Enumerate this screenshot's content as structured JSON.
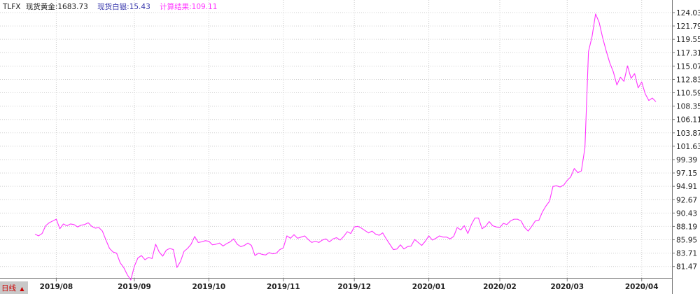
{
  "header": {
    "symbol": "TLFX",
    "gold_label": "现货黄金:1683.73",
    "silver_label": "现货白银:15.43",
    "result_label": "计算结果:109.11"
  },
  "period": {
    "label": "日线",
    "arrow": "▲"
  },
  "colors": {
    "line": "#ff33ff",
    "gold_text": "#222222",
    "silver_text": "#3333aa",
    "result_text": "#ff33ff",
    "grid": "#cfcfcf",
    "axis": "#777777",
    "period_bg": "#c8c8c8",
    "period_text": "#cc0000"
  },
  "chart_data": {
    "type": "line",
    "title": "",
    "xlabel": "",
    "ylabel": "",
    "ylim": [
      79.2,
      124.03
    ],
    "grid": true,
    "y_ticks": [
      "124.03",
      "121.79",
      "119.55",
      "117.31",
      "115.07",
      "112.83",
      "110.59",
      "108.35",
      "106.11",
      "103.87",
      "101.63",
      "99.39",
      "97.15",
      "94.91",
      "92.67",
      "90.43",
      "88.19",
      "85.95",
      "83.71",
      "81.47"
    ],
    "x_ticks": [
      "2019/08",
      "2019/09",
      "2019/10",
      "2019/11",
      "2019/12",
      "2020/01",
      "2020/02",
      "2020/03",
      "2020/04"
    ],
    "x_tick_index": [
      6,
      28,
      49,
      70,
      90,
      111,
      131,
      150,
      171
    ],
    "series": [
      {
        "values": [
          86.9,
          86.6,
          87.0,
          88.3,
          88.8,
          89.1,
          89.4,
          87.8,
          88.6,
          88.3,
          88.6,
          88.5,
          88.1,
          88.4,
          88.5,
          88.8,
          88.2,
          87.9,
          88.0,
          87.4,
          85.9,
          84.5,
          83.9,
          83.7,
          82.1,
          81.3,
          80.1,
          79.2,
          81.5,
          82.9,
          83.3,
          82.6,
          83.0,
          82.8,
          85.2,
          83.9,
          83.2,
          84.2,
          84.5,
          84.3,
          81.3,
          82.3,
          84.0,
          84.5,
          85.2,
          86.5,
          85.5,
          85.6,
          85.8,
          85.7,
          85.1,
          85.2,
          85.4,
          84.9,
          85.3,
          85.6,
          86.1,
          85.2,
          84.8,
          85.0,
          85.4,
          85.0,
          83.3,
          83.7,
          83.5,
          83.4,
          83.8,
          83.6,
          83.7,
          84.3,
          84.6,
          86.6,
          86.2,
          86.8,
          86.2,
          86.4,
          86.6,
          86.0,
          85.5,
          85.7,
          85.5,
          85.9,
          86.1,
          85.6,
          86.1,
          86.3,
          85.9,
          86.5,
          87.3,
          87.0,
          88.1,
          88.2,
          87.9,
          87.5,
          87.1,
          87.4,
          86.9,
          86.7,
          87.1,
          86.1,
          85.2,
          84.3,
          84.4,
          85.1,
          84.4,
          84.8,
          84.9,
          86.0,
          85.5,
          85.0,
          85.7,
          86.6,
          85.9,
          86.2,
          86.6,
          86.4,
          86.4,
          86.1,
          86.5,
          88.0,
          87.6,
          88.3,
          87.0,
          88.5,
          89.6,
          89.6,
          87.8,
          88.2,
          89.0,
          88.3,
          88.1,
          88.0,
          88.7,
          88.5,
          89.1,
          89.4,
          89.4,
          89.1,
          88.0,
          87.4,
          88.2,
          89.1,
          89.2,
          90.6,
          91.6,
          92.4,
          94.9,
          95.0,
          94.8,
          95.1,
          95.9,
          96.5,
          97.9,
          97.2,
          97.5,
          101.4,
          117.5,
          120.0,
          123.8,
          122.4,
          119.8,
          117.6,
          115.6,
          114.1,
          111.9,
          113.2,
          112.5,
          115.1,
          113.0,
          113.8,
          111.4,
          112.4,
          110.4,
          109.3,
          109.7,
          109.1
        ]
      }
    ]
  }
}
